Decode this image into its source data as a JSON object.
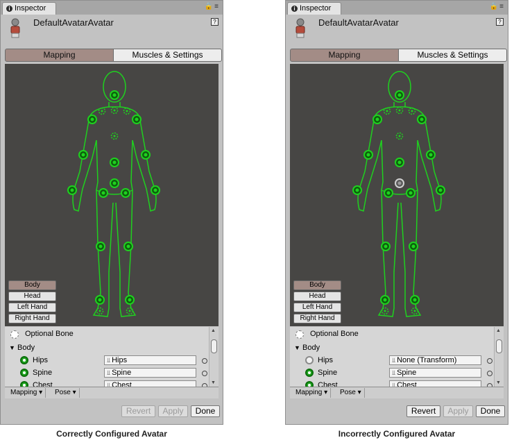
{
  "panels": [
    {
      "tab_label": "Inspector",
      "title": "DefaultAvatarAvatar",
      "mode_tabs": {
        "active": "Mapping",
        "inactive": "Muscles & Settings"
      },
      "body_parts": [
        "Body",
        "Head",
        "Left Hand",
        "Right Hand"
      ],
      "optional_bone": "Optional Bone",
      "group_label": "Body",
      "rows": [
        {
          "label": "Hips",
          "value": "Hips",
          "status": "mapped"
        },
        {
          "label": "Spine",
          "value": "Spine",
          "status": "mapped"
        },
        {
          "label": "Chest",
          "value": "Chest",
          "status": "mapped"
        }
      ],
      "dropdowns": [
        "Mapping",
        "Pose"
      ],
      "buttons": {
        "revert": "Revert",
        "apply": "Apply",
        "done": "Done",
        "revert_enabled": false
      },
      "hips_state": "ok",
      "caption": "Correctly Configured Avatar"
    },
    {
      "tab_label": "Inspector",
      "title": "DefaultAvatarAvatar",
      "mode_tabs": {
        "active": "Mapping",
        "inactive": "Muscles & Settings"
      },
      "body_parts": [
        "Body",
        "Head",
        "Left Hand",
        "Right Hand"
      ],
      "optional_bone": "Optional Bone",
      "group_label": "Body",
      "rows": [
        {
          "label": "Hips",
          "value": "None (Transform)",
          "status": "missing"
        },
        {
          "label": "Spine",
          "value": "Spine",
          "status": "mapped"
        },
        {
          "label": "Chest",
          "value": "Chest",
          "status": "mapped"
        }
      ],
      "dropdowns": [
        "Mapping",
        "Pose"
      ],
      "buttons": {
        "revert": "Revert",
        "apply": "Apply",
        "done": "Done",
        "revert_enabled": true
      },
      "hips_state": "missing",
      "caption": "Incorrectly Configured Avatar"
    }
  ],
  "colors": {
    "bone_green": "#1fd11f",
    "active_tab": "#a38c86",
    "viewport_bg": "#474644"
  }
}
